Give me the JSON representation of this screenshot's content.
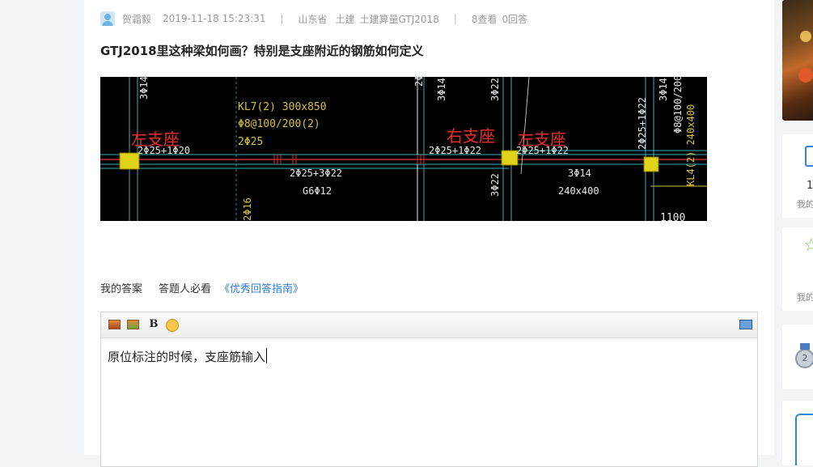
{
  "question": {
    "author": "贺霜毅",
    "datetime": "2019-11-18 15:23:31",
    "province": "山东省",
    "category": "土建",
    "subcategory": "土建算量GTJ2018",
    "views": "8查看",
    "answers": "0回答",
    "title": "GTJ2018里这种梁如何画？特别是支座附近的钢筋如何定义"
  },
  "cad_image": {
    "labels": {
      "left_support_1": "左支座",
      "right_support": "右支座",
      "left_support_2": "左支座"
    },
    "annotations": {
      "beam_name": "KL7(2) 300x850",
      "stirrup": "Φ8@100/200(2)",
      "top_bars": "2Φ25",
      "left_support_bars": "2Φ25+1Φ20",
      "bottom_bars": "2Φ25+3Φ22",
      "side_bars": "G6Φ12",
      "right_support_bars": "2Φ25+1Φ22",
      "left_support_bars_2": "2Φ25+1Φ22",
      "beam2_bars": "3Φ14",
      "beam2_size": "240x400",
      "vertical_stirrup": "Φ8@100/200",
      "vertical_beam": "KL4(2) 240x400",
      "vertical_bars": "2Φ25+1Φ22",
      "col_bars_1": "3Φ14",
      "col_bars_2": "2Φ14",
      "col_bars_3": "3Φ14",
      "col_bars_4": "3Φ22",
      "col_bars_5": "3Φ22",
      "col_bars_6": "3Φ14",
      "col_bars_7": "2Φ16",
      "dim_1100": "1100"
    }
  },
  "answer_tabs": {
    "my_answer": "我的答案",
    "must_read": "答题人必看",
    "guide_link": "《优秀回答指南》"
  },
  "editor": {
    "content": "原位标注的时候，支座筋输入"
  },
  "right_sidebar": {
    "box1_num": "1",
    "box1_label": "我的",
    "box2_label": "我的",
    "medal_number": "2"
  }
}
